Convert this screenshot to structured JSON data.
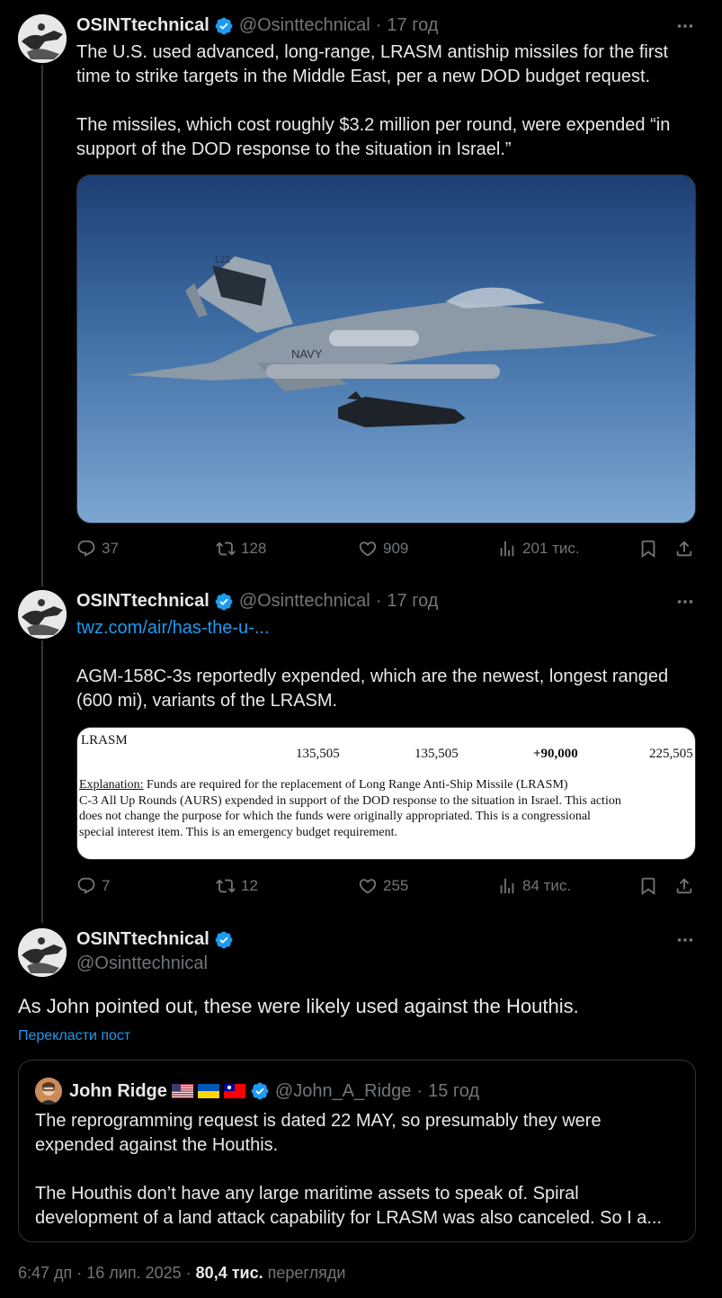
{
  "tweet1": {
    "name": "OSINTtechnical",
    "handle": "@Osinttechnical",
    "time": "17 год",
    "text_p1": "The U.S. used advanced, long-range, LRASM antiship missiles for the first time to strike targets in the Middle East, per a new DOD budget request.",
    "text_p2": "The missiles, which cost roughly $3.2 million per round, were expended “in support of the DOD response to the situation in Israel.”",
    "image_alt": "F/A-18 Super Hornet carrying LRASM missile",
    "jet_label_navy": "NAVY",
    "jet_label_tail": "122",
    "replies": "37",
    "reposts": "128",
    "likes": "909",
    "views": "201 тис."
  },
  "tweet2": {
    "name": "OSINTtechnical",
    "handle": "@Osinttechnical",
    "time": "17 год",
    "link": "twz.com/air/has-the-u-...",
    "text": "AGM-158C-3s reportedly expended, which are the newest, longest ranged (600 mi), variants of the LRASM.",
    "doc": {
      "title": "LRASM",
      "col1": "135,505",
      "col2": "135,505",
      "col3": "+90,000",
      "col4": "225,505",
      "explanation_label": "Explanation:",
      "line1": " Funds are required for the replacement of Long Range Anti-Ship Missile (LRASM)",
      "line2": "C-3 All Up Rounds (AURS) expended in support of the DOD response to the situation in Israel.  This action",
      "line3": "does not change the purpose for which the funds were originally appropriated.  This is a congressional",
      "line4": "special interest item.  This is an emergency budget requirement."
    },
    "replies": "7",
    "reposts": "12",
    "likes": "255",
    "views": "84 тис."
  },
  "tweet3": {
    "name": "OSINTtechnical",
    "handle": "@Osinttechnical",
    "text": "As John pointed out, these were likely used against the Houthis.",
    "translate": "Перекласти пост",
    "footer_time": "6:47 дп · 16 лип. 2025",
    "footer_views": "80,4 тис.",
    "footer_views_label": "перегляди"
  },
  "quote": {
    "name": "John Ridge",
    "handle": "@John_A_Ridge",
    "time": "15 год",
    "text_p1": "The reprogramming request is dated 22 MAY, so presumably they were expended against the Houthis.",
    "text_p2": "The Houthis don’t have any large maritime assets to speak of. Spiral development of a land attack capability for LRASM was also canceled. So I a..."
  },
  "colors": {
    "background": "#000000",
    "text": "#e7e9ea",
    "muted": "#71767b",
    "accent": "#1d9bf0",
    "border": "#2f3336"
  }
}
